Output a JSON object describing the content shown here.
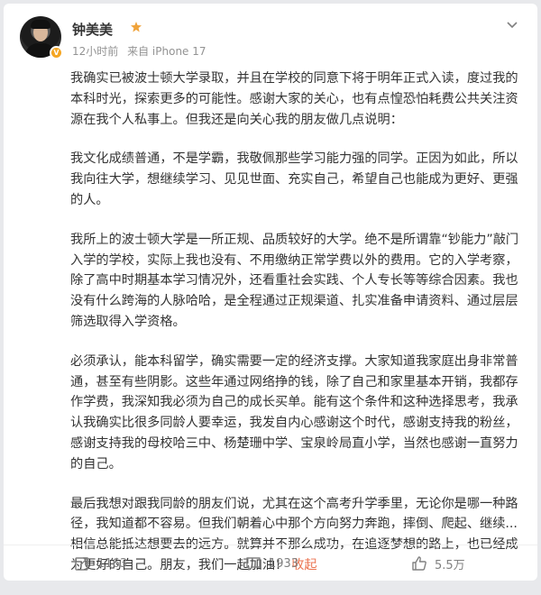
{
  "post": {
    "username": "钟美美",
    "time": "12小时前",
    "source": "来自 iPhone 17",
    "paragraphs": [
      "我确实已被波士顿大学录取，并且在学校的同意下将于明年正式入读，度过我的本科时光，探索更多的可能性。感谢大家的关心，也有点惶恐怕耗费公共关注资源在我个人私事上。但我还是向关心我的朋友做几点说明：",
      "我文化成绩普通，不是学霸，我敬佩那些学习能力强的同学。正因为如此，所以我向往大学，想继续学习、见见世面、充实自己，希望自己也能成为更好、更强的人。",
      "我所上的波士顿大学是一所正规、品质较好的大学。绝不是所谓靠“钞能力”敲门入学的学校，实际上我也没有、不用缴纳正常学费以外的费用。它的入学考察，除了高中时期基本学习情况外，还看重社会实践、个人专长等等综合因素。我也没有什么跨海的人脉哈哈，是全程通过正规渠道、扎实准备申请资料、通过层层筛选取得入学资格。",
      "必须承认，能本科留学，确实需要一定的经济支撑。大家知道我家庭出身非常普通，甚至有些阴影。这些年通过网络挣的钱，除了自己和家里基本开销，我都存作学费，我深知我必须为自己的成长买单。能有这个条件和这种选择思考，我承认我确实比很多同龄人要幸运，我发自内心感谢这个时代，感谢支持我的粉丝，感谢支持我的母校哈三中、杨楚珊中学、宝泉岭局直小学，当然也感谢一直努力的自己。",
      "最后我想对跟我同龄的朋友们说，尤其在这个高考升学季里，无论你是哪一种路径，我知道都不容易。但我们朝着心中那个方向努力奔跑，摔倒、爬起、继续...相信总能抵达想要去的远方。就算并不那么成功，在追逐梦想的路上，也已经成为更好的自己。朋友，我们一起加油！"
    ],
    "collapse_label": "收起"
  },
  "actions": {
    "repost_count": "1163",
    "comment_count": "1933",
    "like_count": "5.5万"
  },
  "colors": {
    "accent_link": "#eb7350",
    "meta_gray": "#939393",
    "verified_badge": "#f5a623"
  },
  "icons": [
    "more-icon",
    "repost-icon",
    "comment-icon",
    "like-icon",
    "level-icon",
    "verified-icon"
  ]
}
